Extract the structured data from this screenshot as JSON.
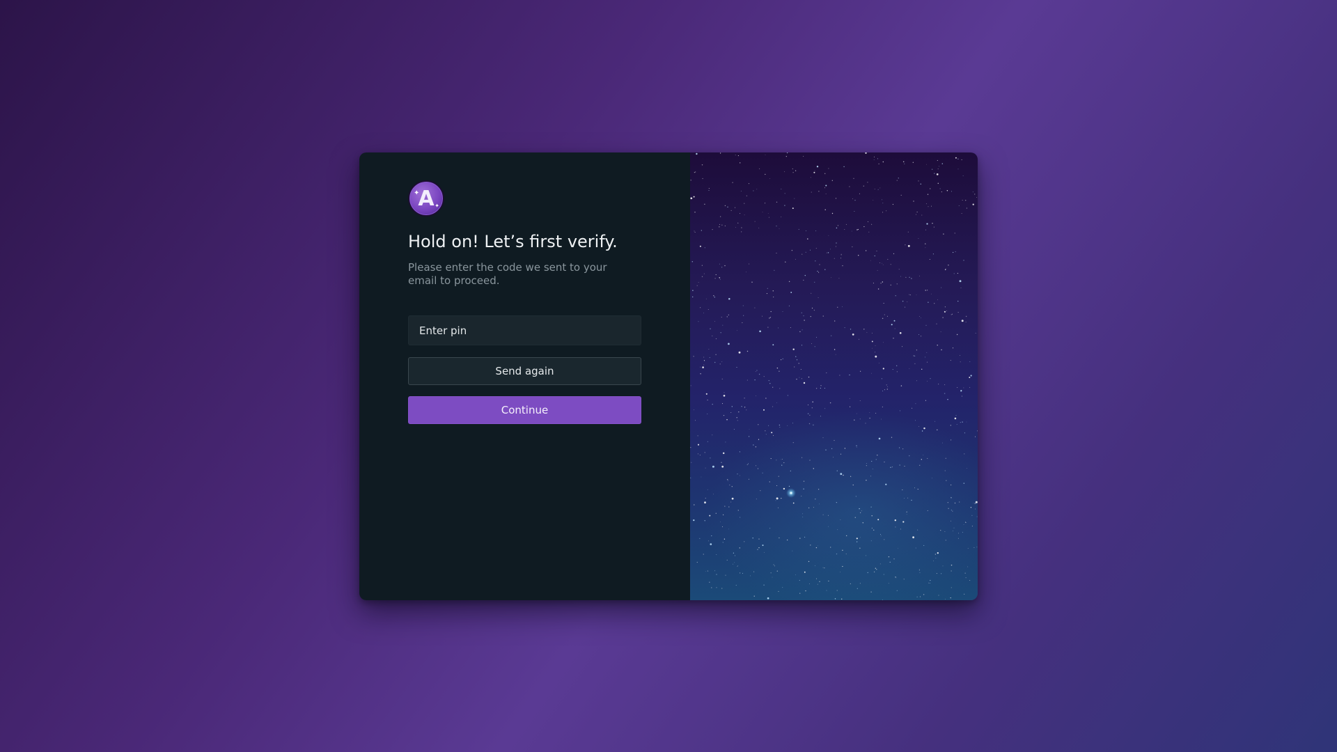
{
  "logo": {
    "letter": "A",
    "icon": "app-logo-icon"
  },
  "verify": {
    "title": "Hold on! Let’s first verify.",
    "subtitle": "Please enter the code we sent to your email to proceed.",
    "pin_placeholder": "Enter pin",
    "send_again_label": "Send again",
    "continue_label": "Continue"
  },
  "colors": {
    "accent": "#7d4cc2",
    "panel": "#0f1b22",
    "input_bg": "#1a262d"
  },
  "hero": {
    "icon": "starry-sky-image"
  }
}
